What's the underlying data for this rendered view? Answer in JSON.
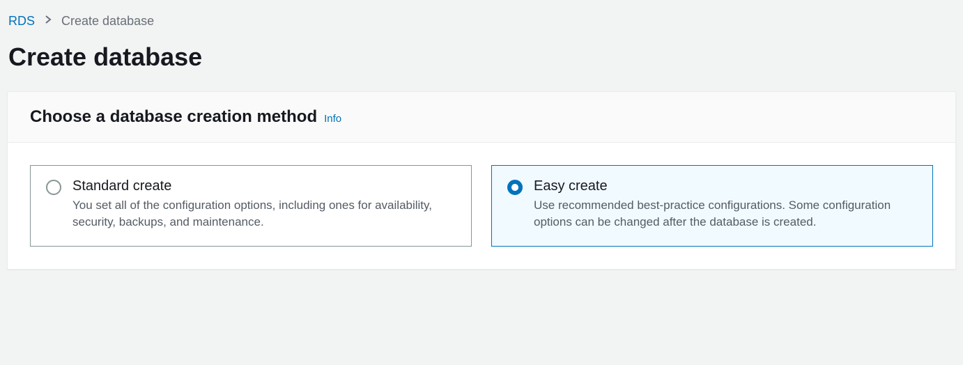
{
  "breadcrumb": {
    "root": "RDS",
    "current": "Create database"
  },
  "page": {
    "title": "Create database"
  },
  "panel": {
    "heading": "Choose a database creation method",
    "info_link": "Info"
  },
  "options": {
    "standard": {
      "label": "Standard create",
      "description": "You set all of the configuration options, including ones for availability, security, backups, and maintenance."
    },
    "easy": {
      "label": "Easy create",
      "description": "Use recommended best-practice configurations. Some configuration options can be changed after the database is created."
    }
  }
}
